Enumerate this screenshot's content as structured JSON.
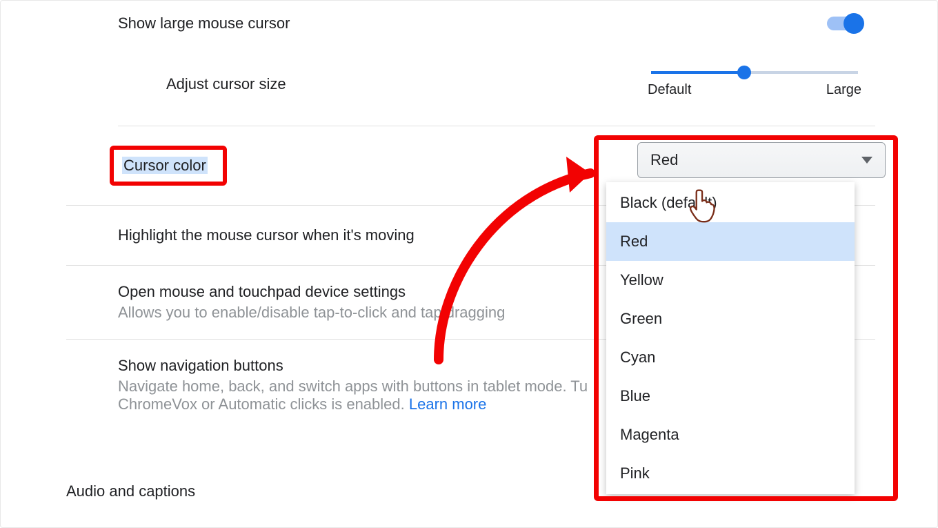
{
  "rows": {
    "large_cursor": "Show large mouse cursor",
    "adjust_size": "Adjust cursor size",
    "slider_min": "Default",
    "slider_max": "Large",
    "cursor_color": "Cursor color",
    "highlight_moving": "Highlight the mouse cursor when it's moving",
    "touchpad_title": "Open mouse and touchpad device settings",
    "touchpad_sub": "Allows you to enable/disable tap-to-click and tap dragging",
    "nav_title": "Show navigation buttons",
    "nav_sub_1": "Navigate home, back, and switch apps with buttons in tablet mode. Tu",
    "nav_sub_2": "ChromeVox or Automatic clicks is enabled.  ",
    "nav_learn_more": "Learn more"
  },
  "section_heading": "Audio and captions",
  "cursor_color_select": {
    "selected": "Red",
    "options": [
      "Black (default)",
      "Red",
      "Yellow",
      "Green",
      "Cyan",
      "Blue",
      "Magenta",
      "Pink"
    ]
  },
  "colors": {
    "accent": "#1a73e8",
    "annotation": "#f20202"
  }
}
